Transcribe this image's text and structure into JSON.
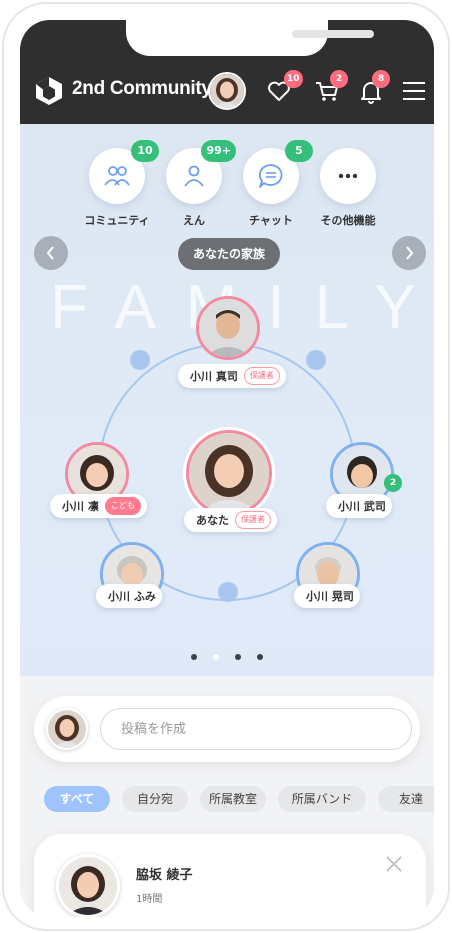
{
  "header": {
    "brand": "2nd Community",
    "badges": {
      "favorites": "10",
      "cart": "2",
      "notifications": "8"
    },
    "icons": [
      "logo-icon",
      "heart-icon",
      "cart-icon",
      "bell-icon",
      "menu-icon"
    ]
  },
  "categories": [
    {
      "label": "コミュニティ",
      "badge": "10",
      "icon": "people-icon"
    },
    {
      "label": "えん",
      "badge": "99+",
      "icon": "person-icon"
    },
    {
      "label": "チャット",
      "badge": "5",
      "icon": "chat-icon"
    },
    {
      "label": "その他機能",
      "badge": "",
      "icon": "more-icon"
    }
  ],
  "family": {
    "title": "あなたの家族",
    "watermark": "FAMILY",
    "members": [
      {
        "id": "shinji",
        "name": "小川 真司",
        "role": "保護者"
      },
      {
        "id": "rin",
        "name": "小川 凛",
        "role": "こども"
      },
      {
        "id": "you",
        "name": "あなた",
        "role": "保護者"
      },
      {
        "id": "takeshi",
        "name": "小川 武司",
        "role": "",
        "badge": "2"
      },
      {
        "id": "fumi",
        "name": "小川 ふみ",
        "role": ""
      },
      {
        "id": "koji",
        "name": "小川 晃司",
        "role": ""
      }
    ],
    "pager": {
      "count": 4,
      "active": 1
    }
  },
  "composer": {
    "placeholder": "投稿を作成"
  },
  "filters": [
    "すべて",
    "自分宛",
    "所属教室",
    "所属バンド",
    "友達"
  ],
  "post": {
    "author": "脇坂 綾子",
    "time": "1時間"
  },
  "colors": {
    "header_bg": "#2f2f2f",
    "badge_pink": "#ff6b7f",
    "badge_green": "#34c07a",
    "ring_blue": "#a9c6f0",
    "chip_active": "#9fc3ff"
  }
}
